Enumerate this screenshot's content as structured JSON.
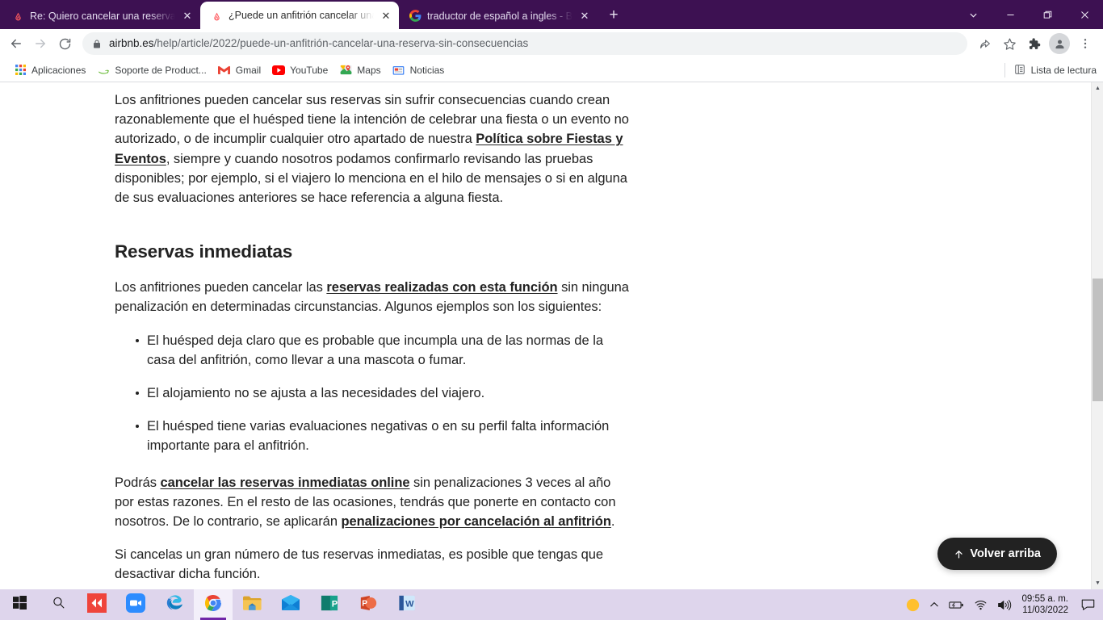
{
  "browser": {
    "theme_color": "#3d1152",
    "tabs": [
      {
        "title": "Re: Quiero cancelar una reserva,",
        "favicon": "airbnb-icon",
        "active": false
      },
      {
        "title": "¿Puede un anfitrión cancelar una",
        "favicon": "airbnb-icon",
        "active": true
      },
      {
        "title": "traductor de español a ingles - Bu",
        "favicon": "google-icon",
        "active": false
      }
    ],
    "new_tab_label": "+",
    "window_controls": {
      "tab_search": "tab-search-chevron-down",
      "minimize": "minimize",
      "maximize": "maximize",
      "close": "close"
    },
    "toolbar": {
      "back": "back-arrow",
      "forward": "forward-arrow",
      "reload": "reload",
      "url_host": "airbnb.es",
      "url_path": "/help/article/2022/puede-un-anfitrión-cancelar-una-reserva-sin-consecuencias",
      "url_full": "airbnb.es/help/article/2022/puede-un-anfitrión-cancelar-una-reserva-sin-consecuencias",
      "lock": "lock-icon",
      "share": "share-icon",
      "bookmark": "star-icon",
      "extensions": "puzzle-icon",
      "profile": "profile-avatar-icon",
      "menu": "three-dot-menu-icon"
    },
    "bookmarks": [
      {
        "label": "Aplicaciones",
        "icon": "apps-grid-icon"
      },
      {
        "label": "Soporte de Product...",
        "icon": "amazon-icon"
      },
      {
        "label": "Gmail",
        "icon": "gmail-icon"
      },
      {
        "label": "YouTube",
        "icon": "youtube-icon"
      },
      {
        "label": "Maps",
        "icon": "maps-icon"
      },
      {
        "label": "Noticias",
        "icon": "news-icon"
      }
    ],
    "reading_list": {
      "label": "Lista de lectura",
      "icon": "reading-list-icon"
    }
  },
  "page": {
    "paragraph_1": {
      "part_1": "Los anfitriones pueden cancelar sus reservas sin sufrir consecuencias cuando crean razonablemente que el huésped tiene la intención de celebrar una fiesta o un evento no autorizado, o de incumplir cualquier otro apartado de nuestra ",
      "link": "Política sobre Fiestas y Eventos",
      "part_2": ", siempre y cuando nosotros podamos confirmarlo revisando las pruebas disponibles; por ejemplo, si el viajero lo menciona en el hilo de mensajes o si en alguna de sus evaluaciones anteriores se hace referencia a alguna fiesta."
    },
    "heading_1": "Reservas inmediatas",
    "paragraph_2": {
      "part_1": "Los anfitriones pueden cancelar las ",
      "link": "reservas realizadas con esta función",
      "part_2": " sin ninguna penalización en determinadas circunstancias. Algunos ejemplos son los siguientes:"
    },
    "bullets": [
      "El huésped deja claro que es probable que incumpla una de las normas de la casa del anfitrión, como llevar a una mascota o fumar.",
      "El alojamiento no se ajusta a las necesidades del viajero.",
      "El huésped tiene varias evaluaciones negativas o en su perfil falta información importante para el anfitrión."
    ],
    "paragraph_3": {
      "part_1": "Podrás ",
      "link_1": "cancelar las reservas inmediatas online",
      "part_2": " sin penalizaciones 3 veces al año por estas razones. En el resto de las ocasiones, tendrás que ponerte en contacto con nosotros. De lo contrario, se aplicarán ",
      "link_2": "penalizaciones por cancelación al anfitrión",
      "part_3": "."
    },
    "paragraph_4": "Si cancelas un gran número de tus reservas inmediatas, es posible que tengas que desactivar dicha función.",
    "back_to_top": {
      "label": "Volver arriba",
      "icon": "arrow-up-icon",
      "background": "#222222"
    }
  },
  "taskbar": {
    "background": "#ded5ec",
    "items": [
      {
        "name": "start-button",
        "icon": "windows-logo-icon"
      },
      {
        "name": "search-button",
        "icon": "search-icon"
      },
      {
        "name": "anydesk-app",
        "icon": "anydesk-icon"
      },
      {
        "name": "zoom-app",
        "icon": "zoom-camera-icon"
      },
      {
        "name": "edge-app",
        "icon": "edge-icon"
      },
      {
        "name": "chrome-app",
        "icon": "chrome-icon",
        "active": true
      },
      {
        "name": "file-explorer-app",
        "icon": "folder-icon"
      },
      {
        "name": "mail-app",
        "icon": "mail-envelope-icon"
      },
      {
        "name": "publisher-app",
        "icon": "publisher-icon"
      },
      {
        "name": "powerpoint-app",
        "icon": "powerpoint-icon"
      },
      {
        "name": "word-app",
        "icon": "word-icon"
      }
    ],
    "tray": [
      {
        "name": "orange-circle-icon",
        "icon": "orange-circle"
      },
      {
        "name": "show-hidden-icons",
        "icon": "chevron-up-icon"
      },
      {
        "name": "battery-icon",
        "icon": "battery"
      },
      {
        "name": "network-icon",
        "icon": "wifi"
      },
      {
        "name": "volume-icon",
        "icon": "speaker"
      }
    ],
    "clock": {
      "time": "09:55 a. m.",
      "date": "11/03/2022"
    },
    "notifications": {
      "name": "notification-center",
      "icon": "speech-bubble-icon"
    }
  }
}
